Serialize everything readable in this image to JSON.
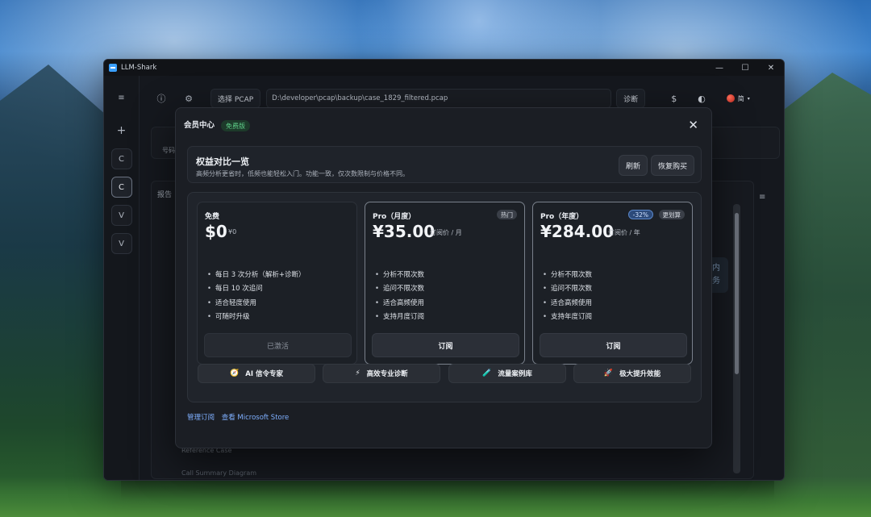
{
  "window": {
    "title": "LLM-Shark",
    "controls": [
      "—",
      "☐",
      "✕"
    ]
  },
  "sidebar": {
    "menu_icon": "≡",
    "add_icon": "+",
    "items": [
      "C",
      "C",
      "V",
      "V"
    ]
  },
  "toolbar": {
    "info_icon": "ⓘ",
    "settings_icon": "⚙",
    "select_pcap_label": "选择 PCAP",
    "pcap_path": "D:\\developer\\pcap\\backup\\case_1829_filtered.pcap",
    "diagnose_label": "诊断",
    "dollar_icon": "$",
    "theme_icon": "◐",
    "lang_label": "简",
    "lang_caret": "▾"
  },
  "background": {
    "hao_label": "号码",
    "report_label": "报告",
    "menu_icon": "≡",
    "chip_line1": "内",
    "chip_line2": "务",
    "ref_case": "Reference Case",
    "ref_case2": "Call Summary Diagram"
  },
  "modal": {
    "title": "会员中心",
    "free_badge": "免费版",
    "close_icon": "✕",
    "compare": {
      "title": "权益对比一览",
      "subtitle": "高频分析更省时，低频也能轻松入门。功能一致，仅次数限制与价格不同。",
      "refresh_label": "刷新",
      "restore_label": "恢复购买"
    },
    "plans": [
      {
        "name": "免费",
        "price": "$0",
        "unit": "¥0",
        "tags": [],
        "features": [
          "每日 3 次分析（解析+诊断）",
          "每日 10 次追问",
          "适合轻度使用",
          "可随时升级"
        ],
        "button": "已激活",
        "button_disabled": true
      },
      {
        "name": "Pro（月度）",
        "price": "¥35.00",
        "unit": "订阅价 / 月",
        "tags": [
          "热门"
        ],
        "features": [
          "分析不限次数",
          "追问不限次数",
          "适合高频使用",
          "支持月度订阅"
        ],
        "button": "订阅",
        "button_disabled": false
      },
      {
        "name": "Pro（年度）",
        "price": "¥284.00",
        "unit": "订阅价 / 年",
        "tags": [
          "-32%",
          "更划算"
        ],
        "features": [
          "分析不限次数",
          "追问不限次数",
          "适合高频使用",
          "支持年度订阅"
        ],
        "button": "订阅",
        "button_disabled": false
      }
    ],
    "perks": [
      {
        "icon": "🧭",
        "label": "AI 信令专家"
      },
      {
        "icon": "⚡",
        "label": "高效专业诊断"
      },
      {
        "icon": "🧪",
        "label": "流量案例库"
      },
      {
        "icon": "🚀",
        "label": "极大提升效能"
      }
    ],
    "links": {
      "manage": "管理订阅",
      "store": "查看 Microsoft Store"
    }
  },
  "colors": {
    "accent_link": "#7fb0ff",
    "free_badge_text": "#5fd08a",
    "discount_tag": "#2c4a7a"
  }
}
